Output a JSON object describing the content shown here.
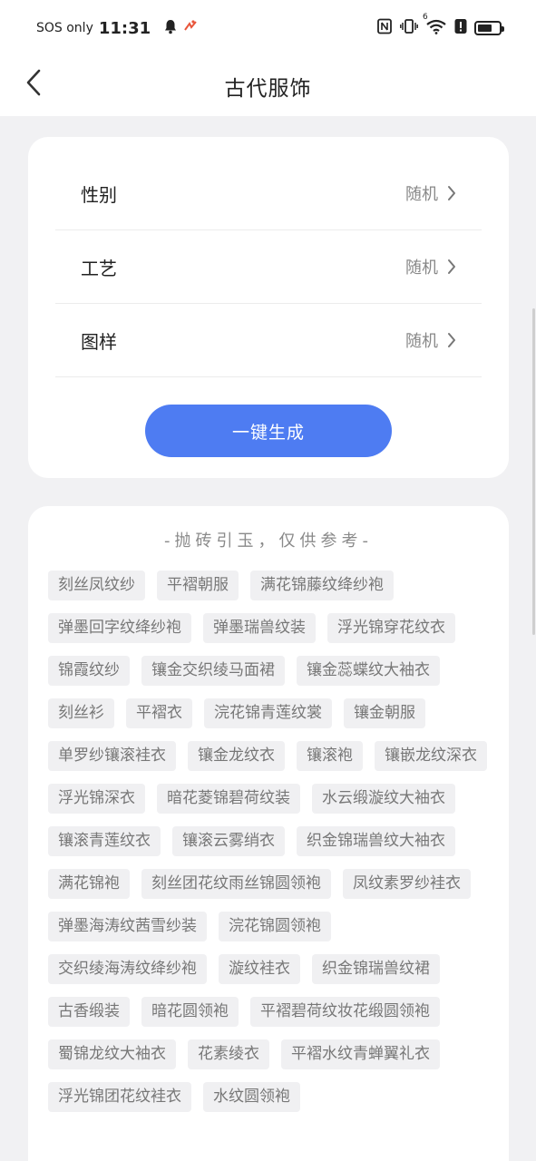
{
  "status_bar": {
    "carrier": "SOS only",
    "time": "11:31",
    "icons": [
      "bell-icon",
      "activity-icon",
      "nfc-icon",
      "vibrate-icon",
      "wifi-icon",
      "alert-icon",
      "battery-icon"
    ],
    "wifi_label": "6",
    "battery_level": 0.7
  },
  "header": {
    "title": "古代服饰",
    "back_icon": "chevron-left-icon"
  },
  "options": [
    {
      "label": "性别",
      "value": "随机"
    },
    {
      "label": "工艺",
      "value": "随机"
    },
    {
      "label": "图样",
      "value": "随机"
    }
  ],
  "generate_button": "一键生成",
  "suggestions": {
    "heading": "-抛砖引玉，仅供参考-",
    "tags": [
      "刻丝凤纹纱",
      "平褶朝服",
      "满花锦藤纹绛纱袍",
      "弹墨回字纹绛纱袍",
      "弹墨瑞兽纹装",
      "浮光锦穿花纹衣",
      "锦霞纹纱",
      "镶金交织绫马面裙",
      "镶金蕊蝶纹大袖衣",
      "刻丝衫",
      "平褶衣",
      "浣花锦青莲纹裳",
      "镶金朝服",
      "单罗纱镶滚袿衣",
      "镶金龙纹衣",
      "镶滚袍",
      "镶嵌龙纹深衣",
      "浮光锦深衣",
      "暗花菱锦碧荷纹装",
      "水云缎漩纹大袖衣",
      "镶滚青莲纹衣",
      "镶滚云雾绡衣",
      "织金锦瑞兽纹大袖衣",
      "满花锦袍",
      "刻丝团花纹雨丝锦圆领袍",
      "凤纹素罗纱袿衣",
      "弹墨海涛纹茜雪纱装",
      "浣花锦圆领袍",
      "交织绫海涛纹绛纱袍",
      "漩纹袿衣",
      "织金锦瑞兽纹裙",
      "古香缎装",
      "暗花圆领袍",
      "平褶碧荷纹妆花缎圆领袍",
      "蜀锦龙纹大袖衣",
      "花素绫衣",
      "平褶水纹青蝉翼礼衣",
      "浮光锦团花纹袿衣",
      "水纹圆领袍"
    ]
  }
}
